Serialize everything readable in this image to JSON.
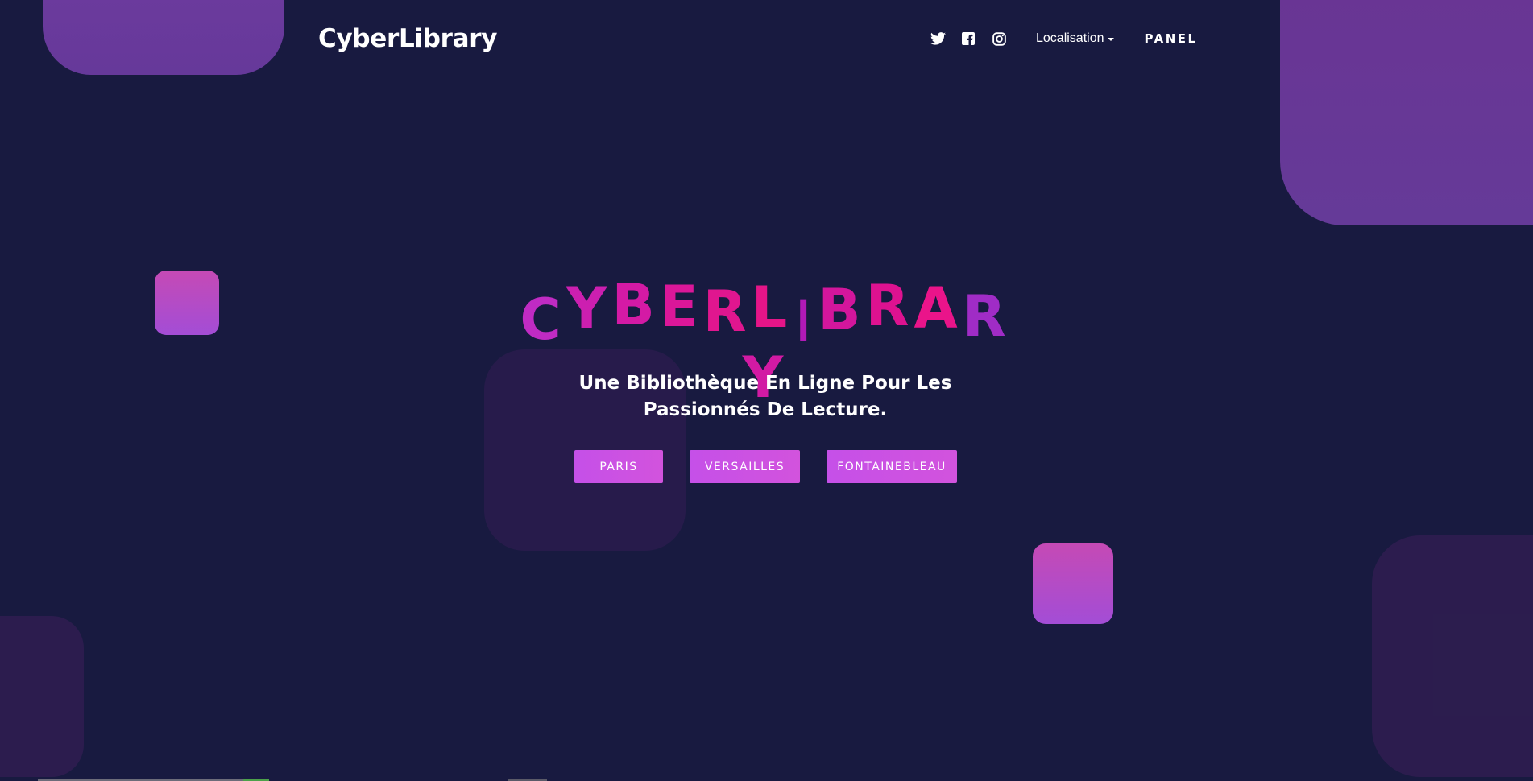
{
  "header": {
    "brand": "CyberLibrary",
    "social_icons": [
      "twitter-icon",
      "facebook-icon",
      "instagram-icon"
    ],
    "dropdown_label": "Localisation",
    "panel_label": "PANEL"
  },
  "hero": {
    "title": "CYBERLIBRARY",
    "title_colors": [
      "#c02bc3",
      "#cc1fb0",
      "#d41aa5",
      "#db1799",
      "#e0168f",
      "#e51588",
      "#b11ab7",
      "#d3169c",
      "#de1290",
      "#ea148a",
      "#a02cc6",
      "#d21aa3"
    ],
    "subtitle": "Une Bibliothèque En Ligne Pour Les Passionnés De Lecture.",
    "buttons": {
      "paris": "PARIS",
      "versailles": "VERSAILLES",
      "fontainebleau": "FONTAINEBLEAU"
    }
  },
  "colors": {
    "background": "#181a40",
    "accent": "#cd52e4",
    "shape_purple": "#6a3a9c",
    "shape_pink": "#c54ab5"
  }
}
